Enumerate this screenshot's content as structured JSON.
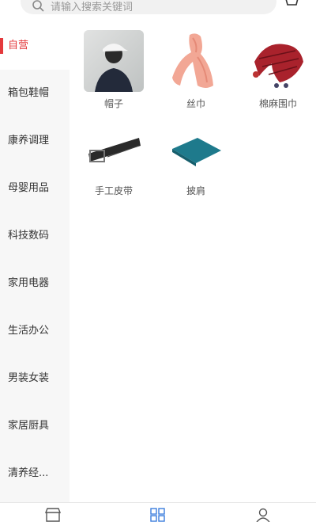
{
  "search": {
    "placeholder": "请输入搜索关键词"
  },
  "sidebar": {
    "items": [
      {
        "label": "自营",
        "active": true
      },
      {
        "label": "箱包鞋帽",
        "active": false
      },
      {
        "label": "康养调理",
        "active": false
      },
      {
        "label": "母婴用品",
        "active": false
      },
      {
        "label": "科技数码",
        "active": false
      },
      {
        "label": "家用电器",
        "active": false
      },
      {
        "label": "生活办公",
        "active": false
      },
      {
        "label": "男装女装",
        "active": false
      },
      {
        "label": "家居厨具",
        "active": false
      },
      {
        "label": "清养经...",
        "active": false
      }
    ]
  },
  "products": [
    {
      "label": "帽子",
      "icon": "person-with-cap-photo"
    },
    {
      "label": "丝巾",
      "icon": "pink-silk-scarf-photo"
    },
    {
      "label": "棉麻围巾",
      "icon": "red-cotton-scarf-photo"
    },
    {
      "label": "手工皮带",
      "icon": "leather-belt-photo"
    },
    {
      "label": "披肩",
      "icon": "teal-shawl-photo"
    }
  ],
  "colors": {
    "accent": "#e4393c",
    "tab_active": "#3b7ddd",
    "sidebar_bg": "#f7f7f7"
  }
}
